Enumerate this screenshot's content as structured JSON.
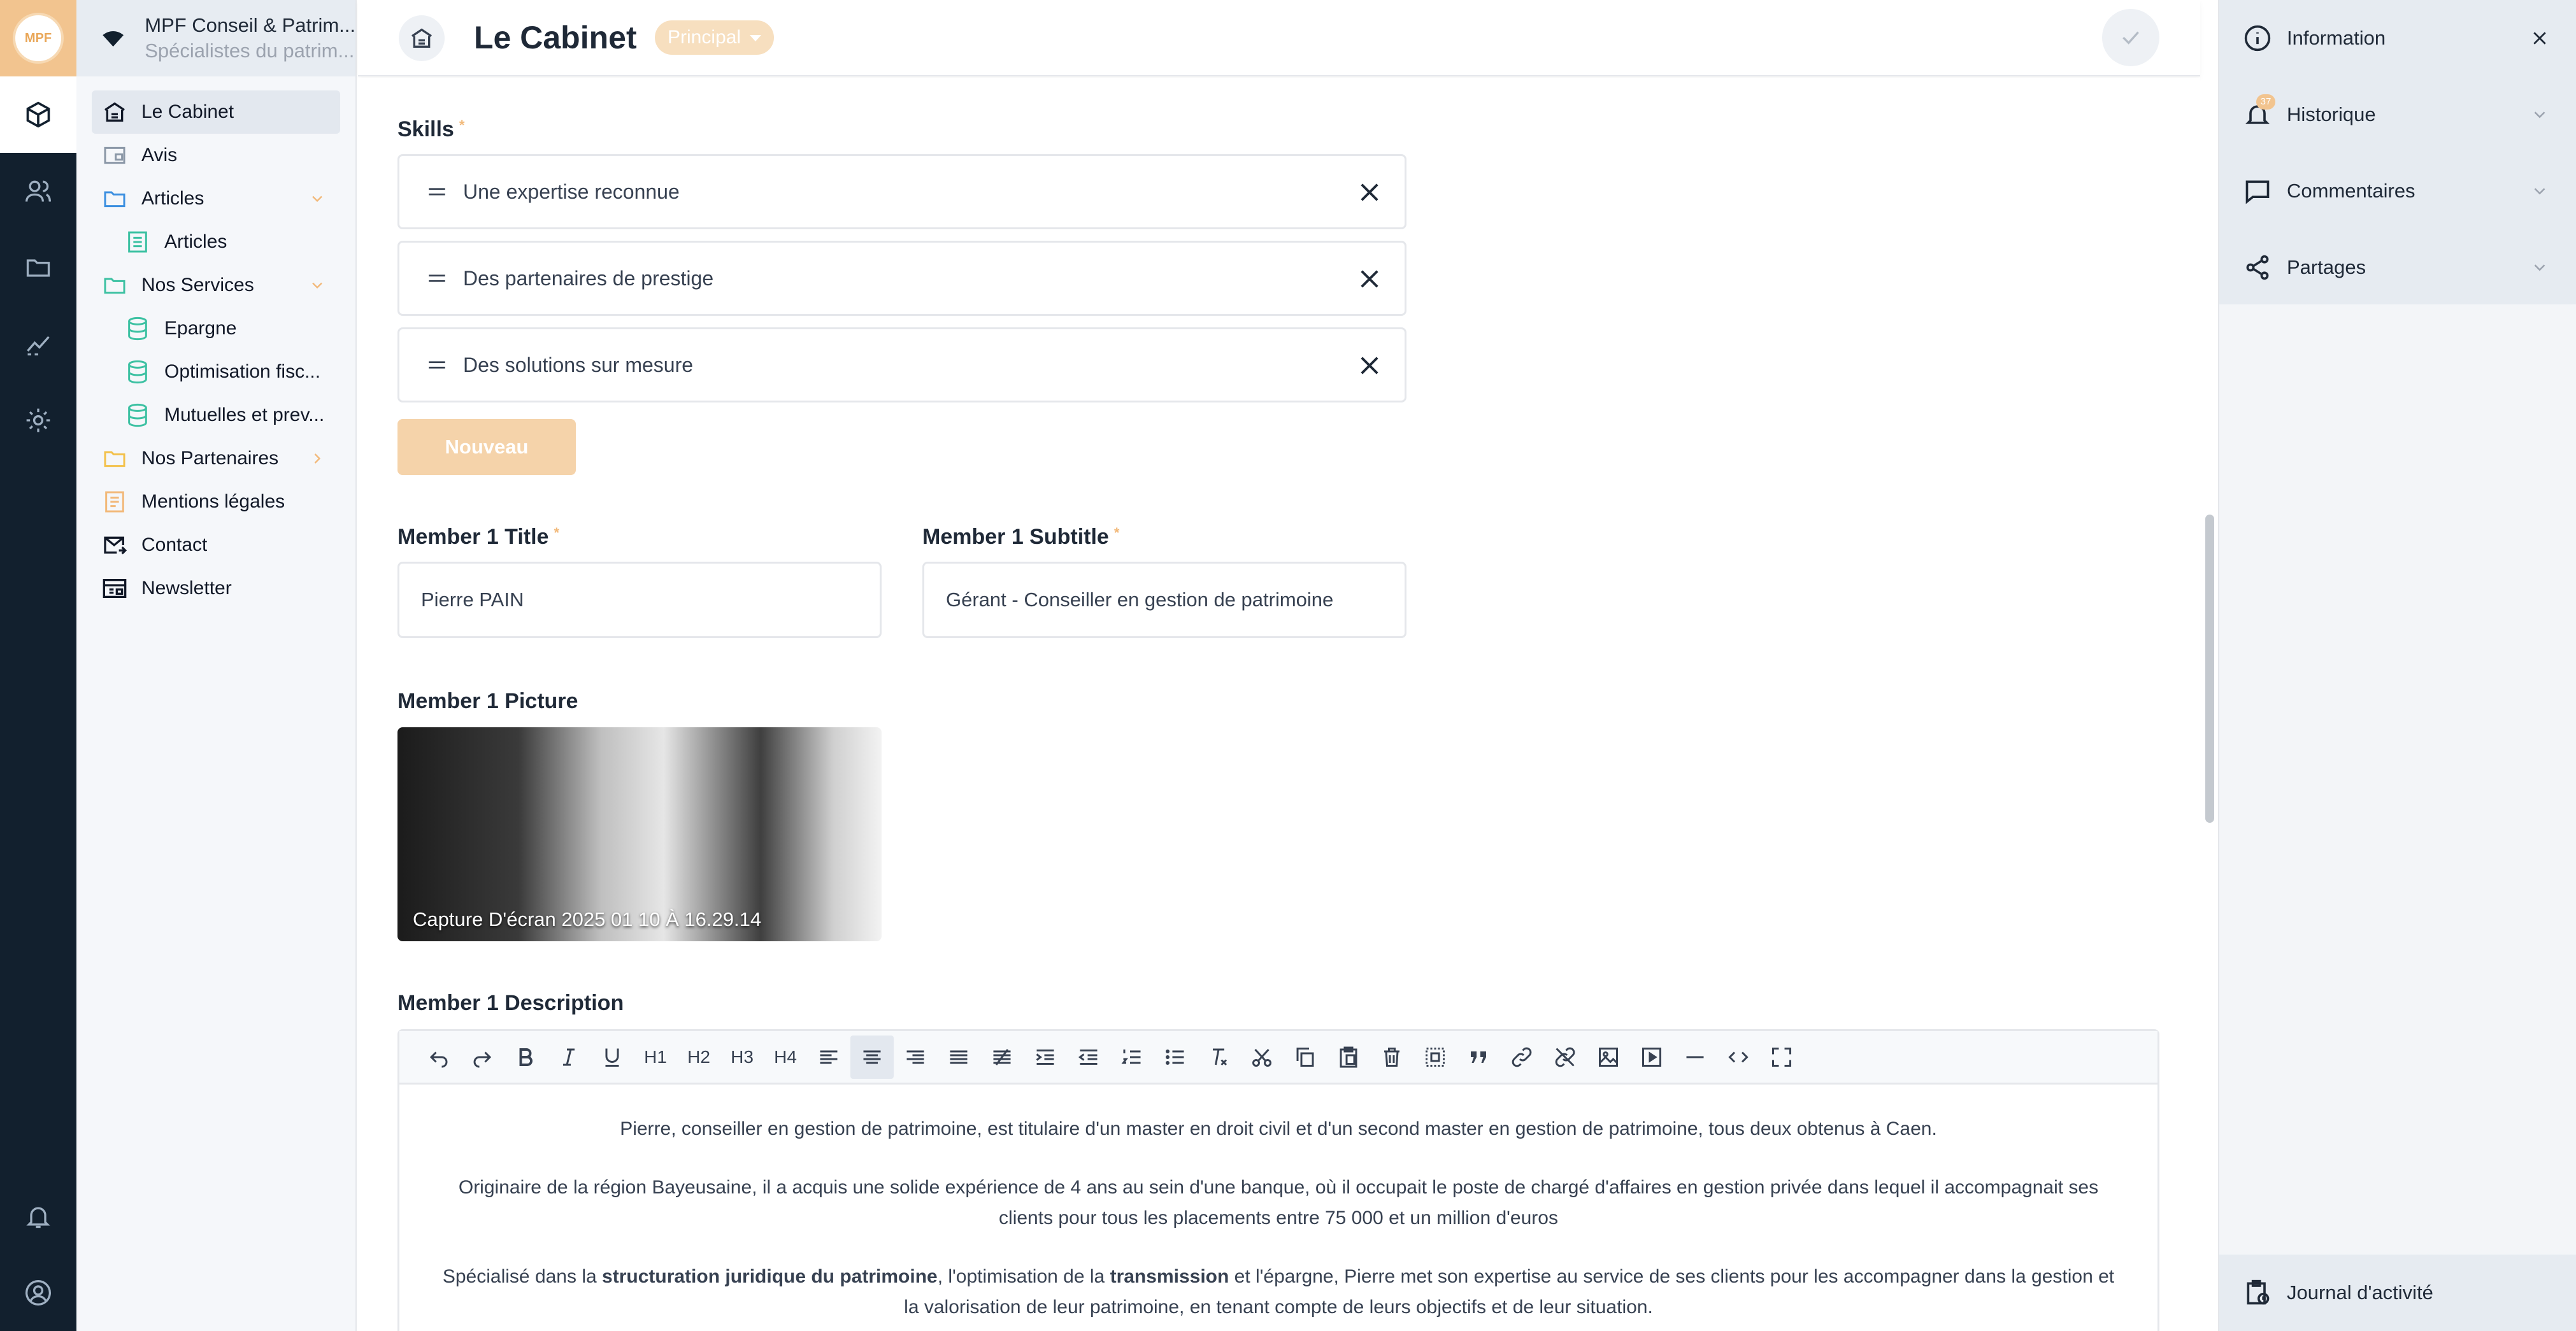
{
  "app": {
    "logo_text": "MPF",
    "org_name": "MPF Conseil & Patrim...",
    "org_subtitle": "Spécialistes du patrim..."
  },
  "rail": {
    "icons": [
      "cube-icon",
      "users-icon",
      "folder-icon",
      "chart-icon",
      "gear-icon",
      "bell-icon",
      "account-icon"
    ]
  },
  "tree": {
    "items": [
      {
        "label": "Le Cabinet",
        "icon": "home-icon",
        "level": 0,
        "selected": true
      },
      {
        "label": "Avis",
        "icon": "page-icon",
        "level": 0
      },
      {
        "label": "Articles",
        "icon": "folder-icon",
        "level": 0,
        "expanded": true
      },
      {
        "label": "Articles",
        "icon": "list-icon",
        "level": 1
      },
      {
        "label": "Nos Services",
        "icon": "folder-icon",
        "level": 0,
        "expanded": true
      },
      {
        "label": "Epargne",
        "icon": "database-icon",
        "level": 1
      },
      {
        "label": "Optimisation fisc...",
        "icon": "database-icon",
        "level": 1
      },
      {
        "label": "Mutuelles et prev...",
        "icon": "database-icon",
        "level": 1
      },
      {
        "label": "Nos Partenaires",
        "icon": "folder-icon",
        "level": 0,
        "collapsed": true
      },
      {
        "label": "Mentions légales",
        "icon": "document-icon",
        "level": 0
      },
      {
        "label": "Contact",
        "icon": "mail-icon",
        "level": 0
      },
      {
        "label": "Newsletter",
        "icon": "newsletter-icon",
        "level": 0
      }
    ]
  },
  "header": {
    "title": "Le Cabinet",
    "badge": "Principal"
  },
  "form": {
    "skills_label": "Skills",
    "required_mark": "*",
    "skills": [
      "Une expertise reconnue",
      "Des partenaires de prestige",
      "Des solutions sur mesure"
    ],
    "new_button": "Nouveau",
    "member_title_label": "Member 1 Title",
    "member_title_value": "Pierre PAIN",
    "member_subtitle_label": "Member 1 Subtitle",
    "member_subtitle_value": "Gérant - Conseiller en gestion de patrimoine",
    "member_picture_label": "Member 1 Picture",
    "member_picture_caption": "Capture D'écran 2025 01 10 À 16.29.14",
    "member_description_label": "Member 1 Description"
  },
  "editor": {
    "toolbar": [
      "undo",
      "redo",
      "bold",
      "italic",
      "underline",
      "H1",
      "H2",
      "H3",
      "H4",
      "align-left",
      "align-center",
      "align-right",
      "justify",
      "strikethrough",
      "indent",
      "outdent",
      "ordered-list",
      "bullet-list",
      "clear-format",
      "cut",
      "copy",
      "paste",
      "delete",
      "select-all",
      "quote",
      "link",
      "unlink",
      "image",
      "video",
      "horizontal-rule",
      "code",
      "fullscreen"
    ],
    "paragraph1": "Pierre, conseiller en gestion de patrimoine, est titulaire d'un master en droit civil et d'un second master en gestion de patrimoine, tous deux obtenus à Caen.",
    "paragraph2": "Originaire de la région Bayeusaine, il a acquis une solide expérience de 4 ans au sein d'une banque, où il occupait le poste de chargé d'affaires en gestion privée dans lequel il accompagnait ses clients pour tous les placements entre 75 000 et un million d'euros",
    "paragraph3_a": "Spécialisé dans la ",
    "paragraph3_b": "structuration juridique du patrimoine",
    "paragraph3_c": ", l'optimisation de la ",
    "paragraph3_d": "transmission",
    "paragraph3_e": " et l'épargne, Pierre met son expertise au service de ses clients pour les accompagner dans la gestion et la valorisation de leur patrimoine, en tenant compte de leurs objectifs et de leur situation."
  },
  "rpanel": {
    "information": "Information",
    "historique": "Historique",
    "historique_count": "37",
    "commentaires": "Commentaires",
    "partages": "Partages",
    "journal": "Journal d'activité"
  },
  "colors": {
    "accent": "#f2c48f",
    "rail_bg": "#12202e",
    "teal_icon": "#3cc1a2",
    "blue_icon": "#3b8fe0",
    "folder_yellow": "#f3c14a"
  }
}
